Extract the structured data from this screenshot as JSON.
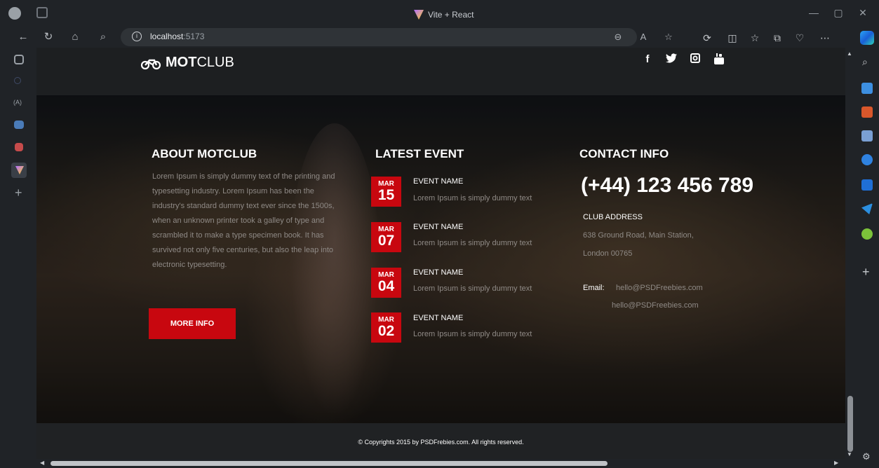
{
  "browser": {
    "tab_title": "Vite + React",
    "url_host": "localhost",
    "url_port": ":5173"
  },
  "site": {
    "logo_bold": "MOT",
    "logo_rest": "CLUB",
    "social": [
      {
        "name": "facebook-icon",
        "glyph": "f"
      },
      {
        "name": "twitter-icon",
        "glyph": "🐦"
      },
      {
        "name": "instagram-icon",
        "glyph": "◙"
      },
      {
        "name": "youtube-icon",
        "glyph": "▶"
      }
    ]
  },
  "about": {
    "title": "ABOUT MOTCLUB",
    "text": "Lorem Ipsum is simply dummy text of the printing and typesetting industry. Lorem Ipsum has been the industry's standard dummy text ever since the 1500s, when an unknown printer took a galley of type and scrambled it to make a type specimen book. It has survived not only five  centuries, but also the leap into electronic typesetting.",
    "button_label": "MORE INFO"
  },
  "events": {
    "title": "LATEST EVENT",
    "items": [
      {
        "month": "MAR",
        "day": "15",
        "name": "EVENT NAME",
        "desc": "Lorem Ipsum is simply dummy text"
      },
      {
        "month": "MAR",
        "day": "07",
        "name": "EVENT NAME",
        "desc": "Lorem Ipsum is simply dummy text"
      },
      {
        "month": "MAR",
        "day": "04",
        "name": "EVENT NAME",
        "desc": "Lorem Ipsum is simply dummy text"
      },
      {
        "month": "MAR",
        "day": "02",
        "name": "EVENT NAME",
        "desc": "Lorem Ipsum is simply dummy text"
      }
    ]
  },
  "contact": {
    "title": "CONTACT INFO",
    "phone": "(+44) 123 456 789",
    "address_label": "CLUB ADDRESS",
    "address_line1": "638 Ground Road, Main Station,",
    "address_line2": "London 00765",
    "email_label": "Email:",
    "email1": "hello@PSDFreebies.com",
    "email2": "hello@PSDFreebies.com"
  },
  "footer": {
    "copyright": "© Copyrights 2015 by PSDFrebies.com. All rights reserved."
  },
  "colors": {
    "accent_red": "#c8070f",
    "chrome_bg": "#202327"
  }
}
